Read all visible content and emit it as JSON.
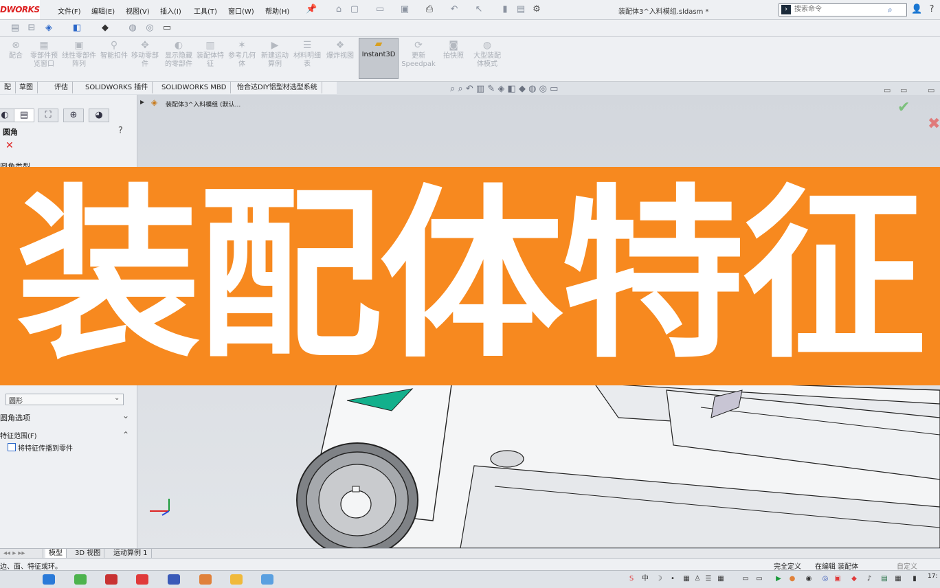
{
  "app": {
    "logo_text": "DWORKS",
    "document_title": "装配体3^入料模组.sldasm *"
  },
  "menu": {
    "items": [
      "文件(F)",
      "编辑(E)",
      "视图(V)",
      "插入(I)",
      "工具(T)",
      "窗口(W)",
      "帮助(H)"
    ]
  },
  "search": {
    "placeholder": "搜索命令"
  },
  "ribbon": {
    "buttons": [
      {
        "label": "配合",
        "icon": "mate-icon"
      },
      {
        "label": "零部件预览窗口",
        "icon": "component-preview-icon"
      },
      {
        "label": "线性零部件阵列",
        "icon": "linear-pattern-icon"
      },
      {
        "label": "智能扣件",
        "icon": "smart-fastener-icon"
      },
      {
        "label": "移动零部件",
        "icon": "move-component-icon"
      },
      {
        "label": "显示隐藏的零部件",
        "icon": "show-hidden-icon"
      },
      {
        "label": "装配体特征",
        "icon": "assembly-feature-icon"
      },
      {
        "label": "参考几何体",
        "icon": "reference-geometry-icon"
      },
      {
        "label": "新建运动算例",
        "icon": "new-motion-study-icon"
      },
      {
        "label": "材料明细表",
        "icon": "bom-icon"
      },
      {
        "label": "爆炸视图",
        "icon": "exploded-view-icon"
      },
      {
        "label": "Instant3D",
        "icon": "instant3d-icon"
      },
      {
        "label": "更新Speedpak",
        "icon": "speedpak-icon"
      },
      {
        "label": "拍快照",
        "icon": "snapshot-icon"
      },
      {
        "label": "大型装配体模式",
        "icon": "large-assembly-icon"
      }
    ]
  },
  "command_tabs": [
    "配",
    "草图",
    "评估",
    "SOLIDWORKS 插件",
    "SOLIDWORKS MBD",
    "怡合达DIY铝型材选型系统"
  ],
  "feature_tree": {
    "root_label": "装配体3^入料模组 (默认..."
  },
  "property_manager": {
    "title": "圆角",
    "section_type": "圆角类型",
    "profile_label": "圆形",
    "options_section": "圆角选项",
    "scope_section": "特征范围(F)",
    "propagate_label": "将特征传播到零件"
  },
  "bottom_tabs": [
    "模型",
    "3D 视图",
    "运动算例 1"
  ],
  "status": {
    "left": "边、面、特征或环。",
    "fully_defined": "完全定义",
    "editing": "在编辑 装配体",
    "custom": "自定义"
  },
  "taskbar": {
    "clock": "17:"
  },
  "banner": {
    "text": "装配体特征",
    "background": "#f7891f",
    "color": "#ffffff"
  }
}
